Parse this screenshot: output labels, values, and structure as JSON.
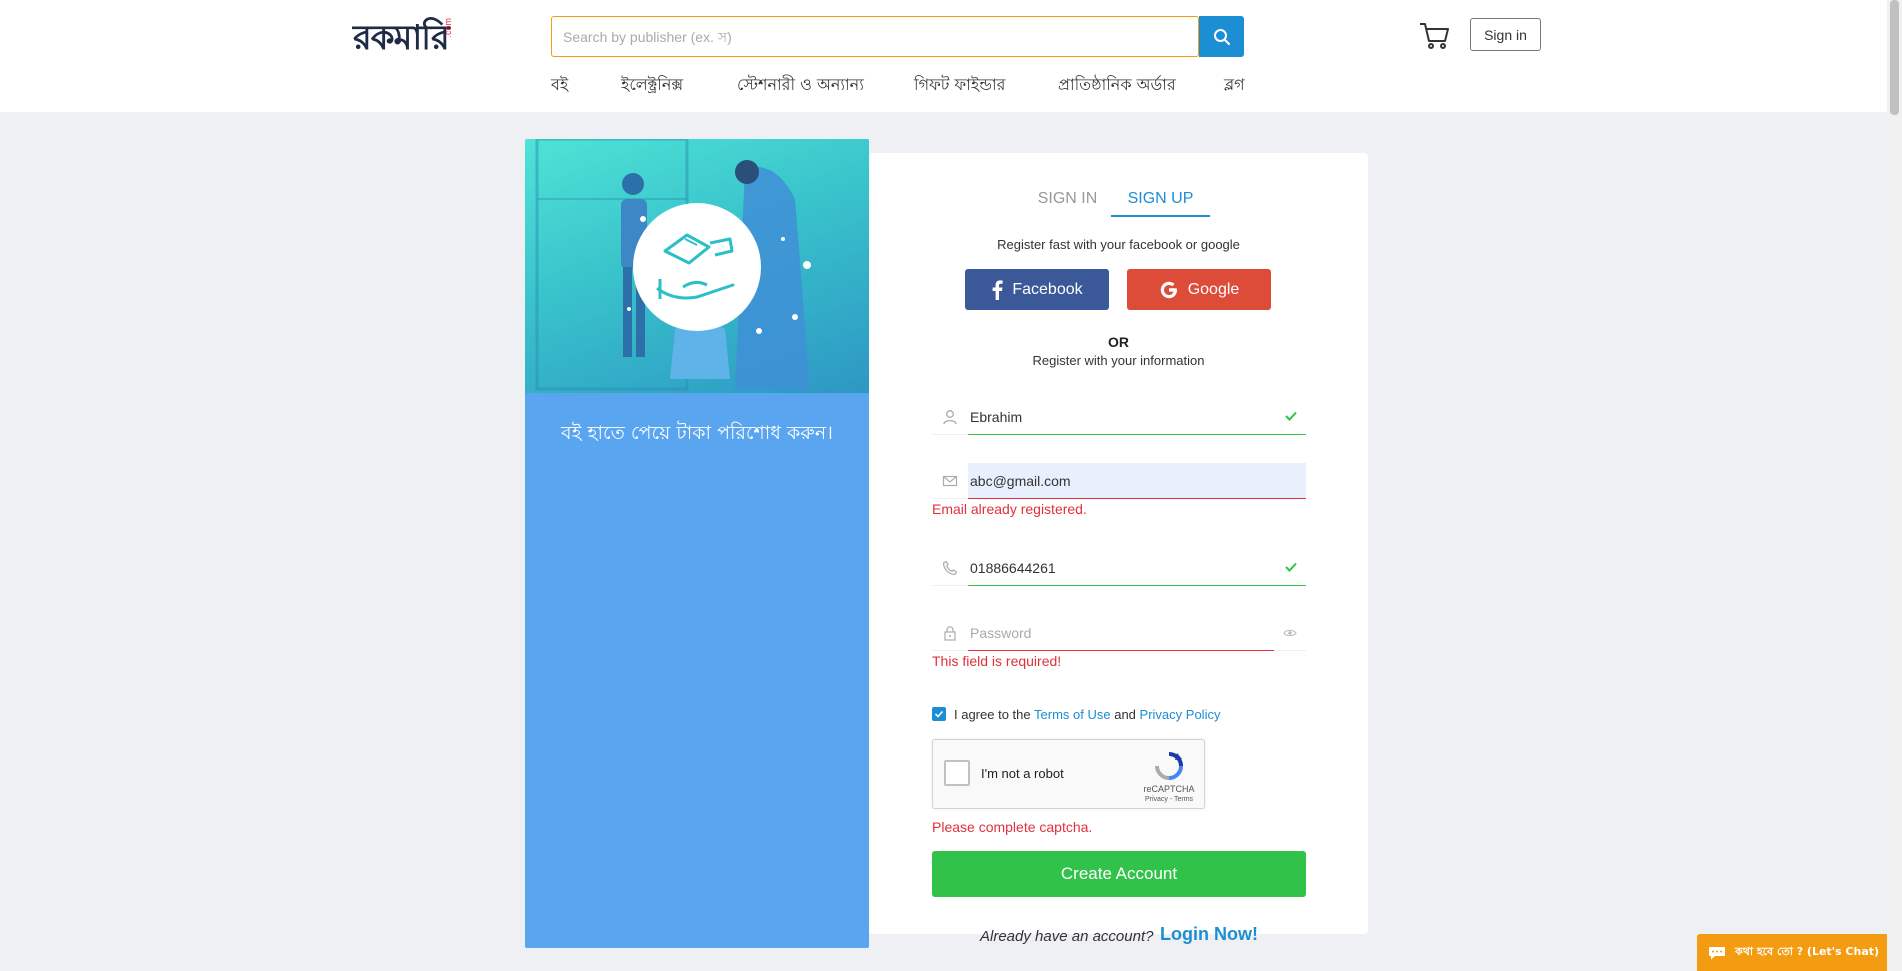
{
  "header": {
    "logo_text_main": "রকমারি",
    "logo_text_com": ".com",
    "search_placeholder": "Search by publisher (ex. স)",
    "signin_label": "Sign in",
    "nav": [
      "বই",
      "ইলেক্ট্রনিক্স",
      "স্টেশনারী ও অন্যান্য",
      "গিফট ফাইন্ডার",
      "প্রাতিষ্ঠানিক অর্ডার",
      "ব্লগ"
    ]
  },
  "promo": {
    "text": "বই হাতে পেয়ে টাকা পরিশোধ করুন।"
  },
  "form": {
    "tabs": {
      "signin": "SIGN IN",
      "signup": "SIGN UP"
    },
    "register_fast": "Register fast with your facebook or google",
    "facebook_label": "Facebook",
    "google_label": "Google",
    "or_label": "OR",
    "register_info": "Register with your information",
    "name_value": "Ebrahim",
    "email_value": "abc@gmail.com",
    "email_error": "Email already registered.",
    "phone_value": "01886644261",
    "password_placeholder": "Password",
    "password_error": "This field is required!",
    "agree_prefix": "I agree to the",
    "terms_label": "Terms of Use",
    "and_label": "and",
    "privacy_label": "Privacy Policy",
    "captcha_label": "I'm not a robot",
    "captcha_brand": "reCAPTCHA",
    "captcha_terms": "Privacy - Terms",
    "captcha_error": "Please complete captcha.",
    "create_label": "Create Account"
  },
  "footer": {
    "already_label": "Already have an account?",
    "login_label": "Login Now!"
  },
  "chat": {
    "label": "কথা হবে তো ? (Let's Chat)"
  },
  "colors": {
    "accent_blue": "#1b8ed4",
    "success_green": "#31c24a",
    "error_red": "#e0313b",
    "facebook_blue": "#3b5998",
    "google_red": "#dd4b39",
    "chat_orange": "#f39c12",
    "promo_blue": "#5aa5ef"
  }
}
